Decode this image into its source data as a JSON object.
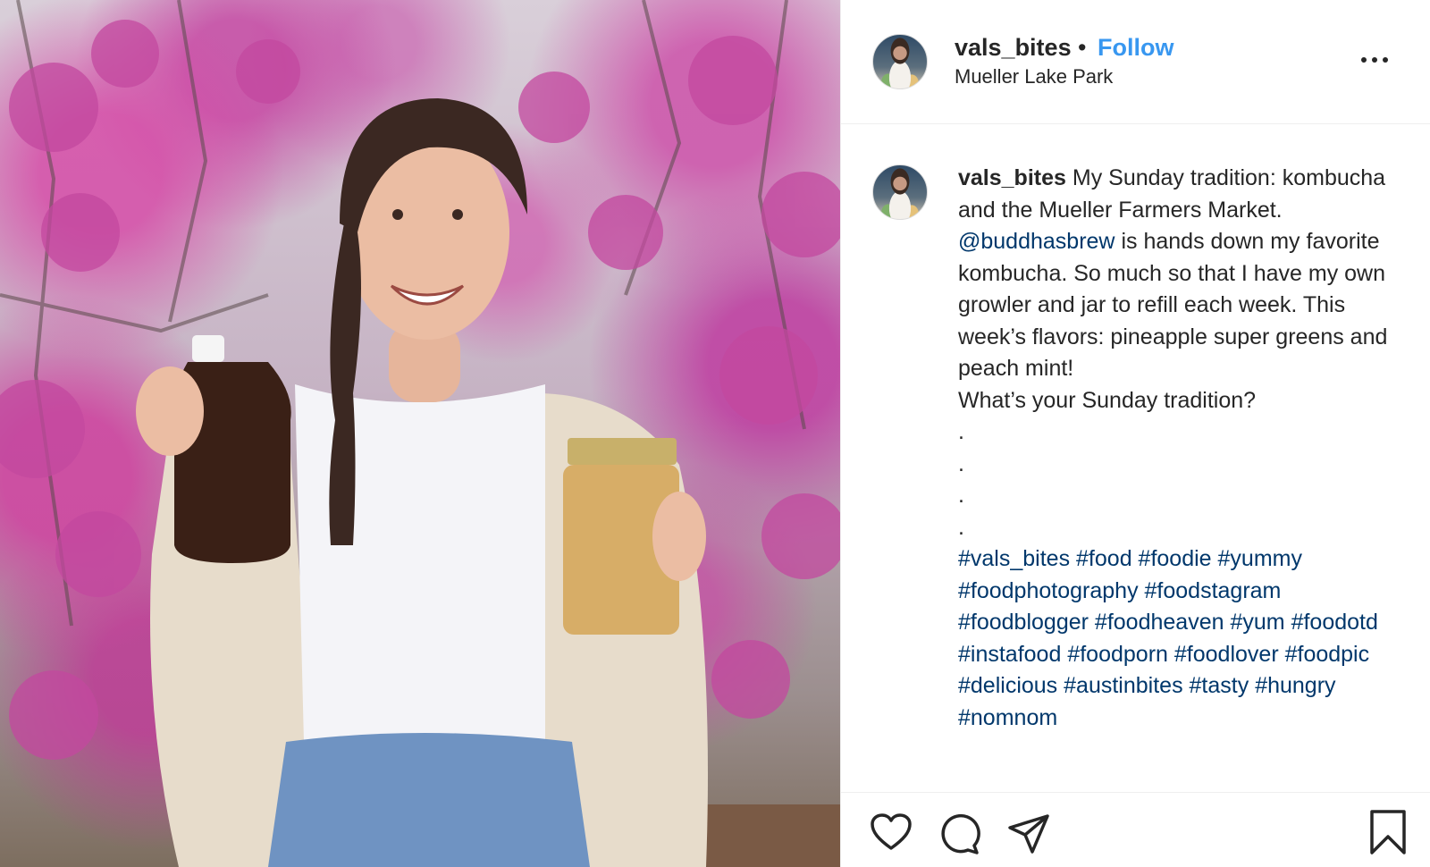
{
  "post": {
    "username": "vals_bites",
    "separator": "•",
    "follow_label": "Follow",
    "location": "Mueller Lake Park"
  },
  "caption": {
    "username": "vals_bites",
    "line1": "My Sunday tradition: kombucha and the Mueller Farmers Market.",
    "mention": "@buddhasbrew",
    "line2": "is hands down my favorite kombucha. So much so that I have my own growler and jar to refill each week. This week’s flavors: pineapple super greens and peach mint!",
    "line3": "What’s your Sunday tradition?",
    "dots": [
      ".",
      ".",
      ".",
      "."
    ],
    "hashtags": [
      "#vals_bites",
      "#food",
      "#foodie",
      "#yummy",
      "#foodphotography",
      "#foodstagram",
      "#foodblogger",
      "#foodheaven",
      "#yum",
      "#foodotd",
      "#instafood",
      "#foodporn",
      "#foodlover",
      "#foodpic",
      "#delicious",
      "#austinbites",
      "#tasty",
      "#hungry",
      "#nomnom"
    ]
  },
  "icons": {
    "more": "more-options-icon",
    "like": "heart-icon",
    "comment": "comment-icon",
    "share": "send-icon",
    "save": "bookmark-icon"
  },
  "colors": {
    "follow": "#3897f0",
    "link": "#00376b",
    "text": "#262626"
  }
}
